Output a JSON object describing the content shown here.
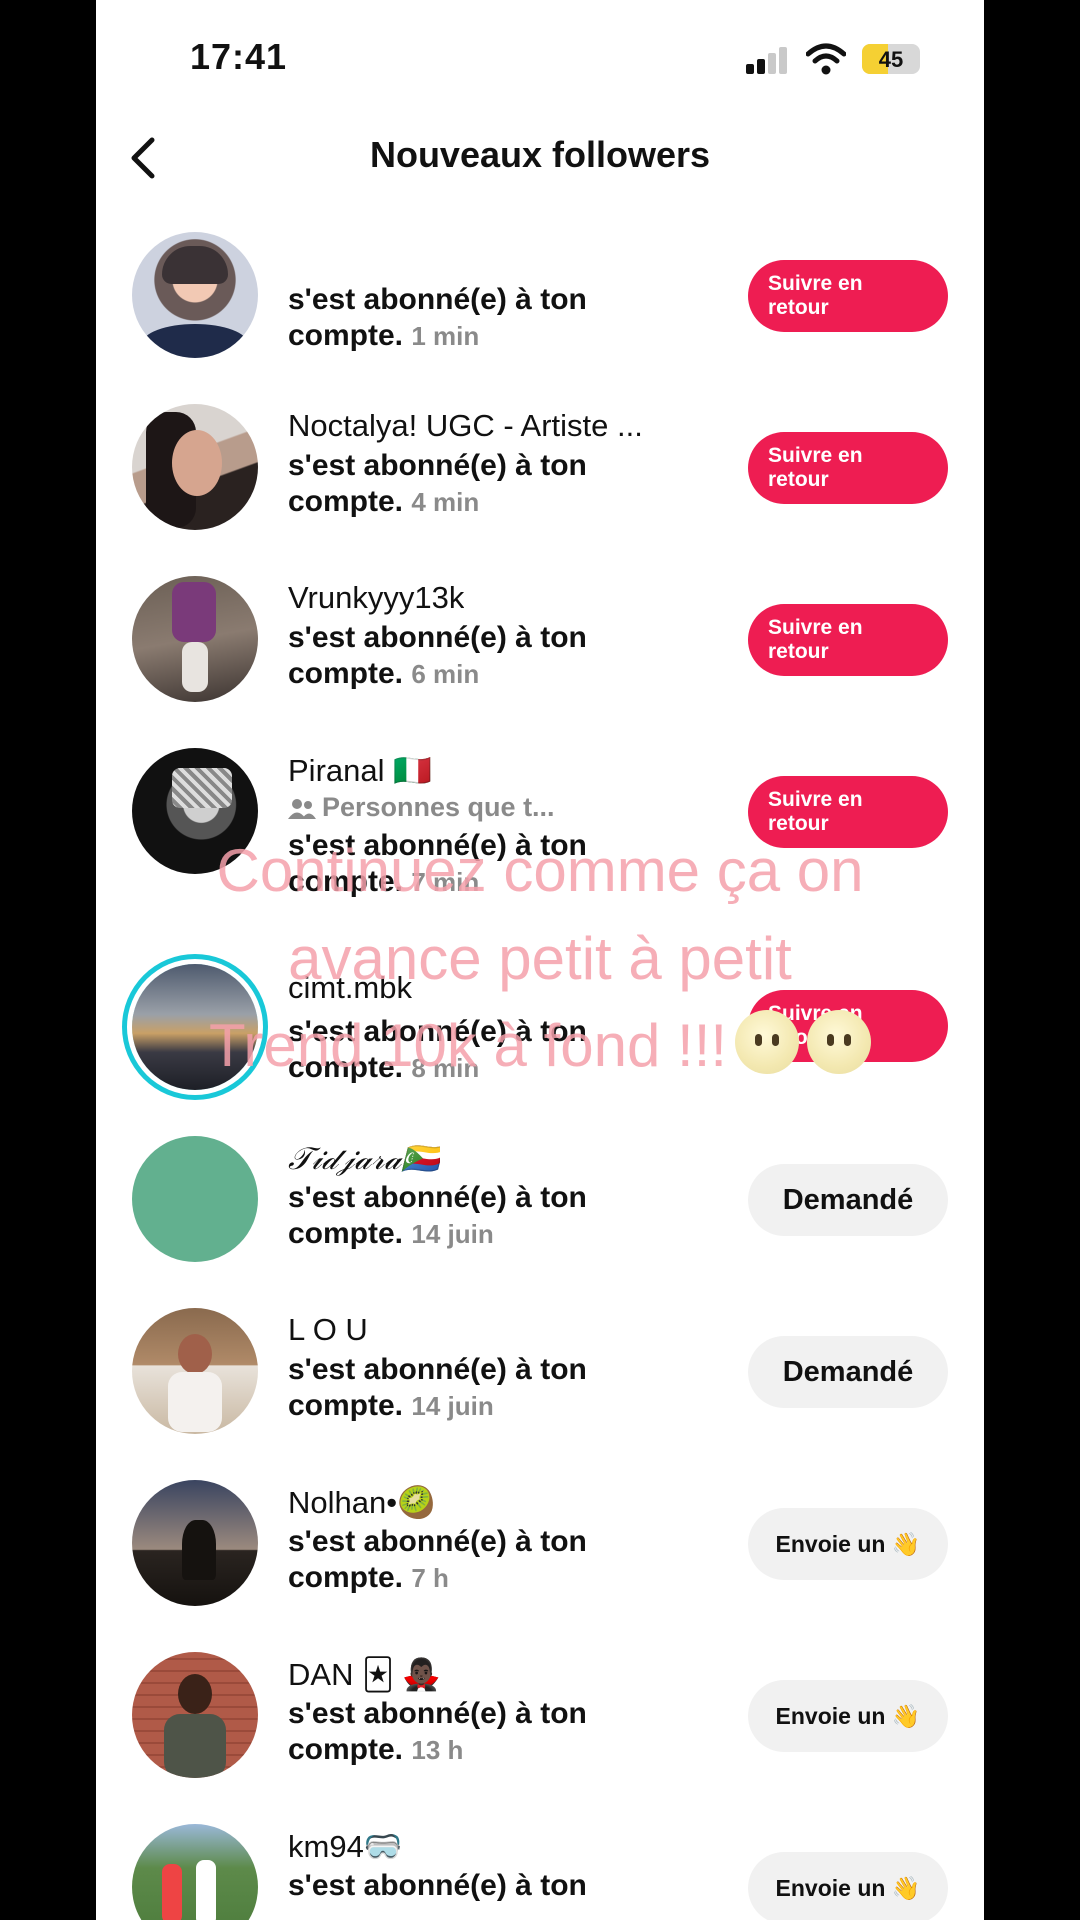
{
  "status_bar": {
    "time": "17:41",
    "battery": "45"
  },
  "header": {
    "title": "Nouveaux followers"
  },
  "followers": [
    {
      "name": "",
      "message": "s'est abonné(e) à ton compte.",
      "time": "1 min",
      "action": "Suivre en retour"
    },
    {
      "name": "Noctalya! UGC - Artiste ...",
      "message": "s'est abonné(e) à ton compte.",
      "time": "4 min",
      "action": "Suivre en retour"
    },
    {
      "name": "Vrunkyyy13k",
      "message": "s'est abonné(e) à ton compte.",
      "time": "6 min",
      "action": "Suivre en retour"
    },
    {
      "name": "Piranal 🇮🇹",
      "mutual": "Personnes que t...",
      "message": "s'est abonné(e) à ton compte.",
      "time": "7 min",
      "action": "Suivre en retour"
    },
    {
      "name": "cimt.mbk",
      "message": "s'est abonné(e) à ton compte.",
      "time": "8 min",
      "action": "Suivre en retour"
    },
    {
      "name": "𝒯𝒾𝒹𝒿𝒶𝓇𝒶🇰🇲",
      "message": "s'est abonné(e) à ton compte.",
      "time": "14 juin",
      "action": "Demandé"
    },
    {
      "name": "L O U",
      "message": "s'est abonné(e) à ton compte.",
      "time": "14 juin",
      "action": "Demandé"
    },
    {
      "name": "Nolhan•🥝",
      "message": "s'est abonné(e) à ton compte.",
      "time": "7 h",
      "action": "Envoie un 👋"
    },
    {
      "name": "DAN 🃏 🧛🏿‍♂️",
      "message": "s'est abonné(e) à ton compte.",
      "time": "13 h",
      "action": "Envoie un 👋"
    },
    {
      "name": "km94🥽",
      "message": "s'est abonné(e) à ton",
      "time": "",
      "action": "Envoie un 👋"
    }
  ],
  "overlay_caption": {
    "line1": "Continuez comme ça on",
    "line2": "avance petit à petit",
    "line3": "Trend 10k à fond !!!"
  },
  "colors": {
    "follow_button": "#ee1d52",
    "neutral_button": "#f1f1f1",
    "caption": "#f4a0aa",
    "story_ring": "#19c8d8"
  }
}
